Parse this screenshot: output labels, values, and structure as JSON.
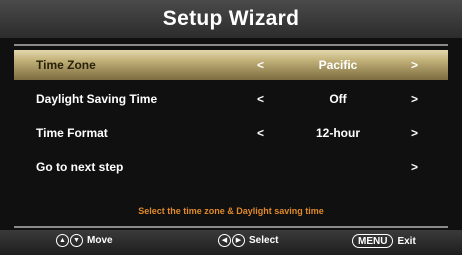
{
  "title": "Setup Wizard",
  "menu": {
    "items": [
      {
        "label": "Time Zone",
        "value": "Pacific",
        "has_left_arrow": true,
        "has_right_arrow": true,
        "selected": true
      },
      {
        "label": "Daylight Saving Time",
        "value": "Off",
        "has_left_arrow": true,
        "has_right_arrow": true,
        "selected": false
      },
      {
        "label": "Time Format",
        "value": "12-hour",
        "has_left_arrow": true,
        "has_right_arrow": true,
        "selected": false
      },
      {
        "label": "Go to next step",
        "value": "",
        "has_left_arrow": false,
        "has_right_arrow": true,
        "selected": false
      }
    ],
    "arrow_left_glyph": "<",
    "arrow_right_glyph": ">"
  },
  "hint": "Select the time zone & Daylight saving time",
  "footer": {
    "move_label": "Move",
    "select_label": "Select",
    "menu_button_text": "MENU",
    "exit_label": "Exit",
    "up_icon": "up-arrow-icon",
    "down_icon": "down-arrow-icon",
    "left_icon": "left-arrow-icon",
    "right_icon": "right-arrow-icon"
  },
  "colors": {
    "selected_row": "#c1b078",
    "hint_text": "#e08a2a",
    "title_bar": "#3a3a3a"
  }
}
